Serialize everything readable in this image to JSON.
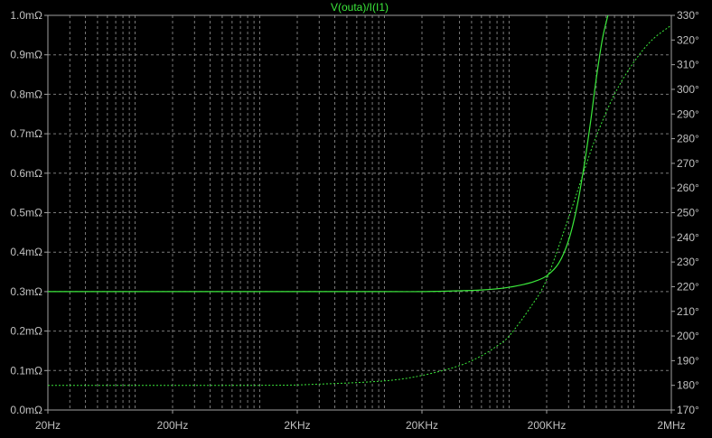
{
  "chart_data": {
    "type": "line",
    "title": "V(outa)/I(I1)",
    "x_scale": "log",
    "xlim": [
      20,
      2000000
    ],
    "x_ticks": [
      {
        "value": 20,
        "label": "20Hz"
      },
      {
        "value": 200,
        "label": "200Hz"
      },
      {
        "value": 2000,
        "label": "2KHz"
      },
      {
        "value": 20000,
        "label": "20KHz"
      },
      {
        "value": 200000,
        "label": "200KHz"
      },
      {
        "value": 2000000,
        "label": "2MHz"
      }
    ],
    "y_left": {
      "lim": [
        0,
        1.0
      ],
      "unit": "mΩ",
      "ticks": [
        {
          "value": 0.0,
          "label": "0.0mΩ"
        },
        {
          "value": 0.1,
          "label": "0.1mΩ"
        },
        {
          "value": 0.2,
          "label": "0.2mΩ"
        },
        {
          "value": 0.3,
          "label": "0.3mΩ"
        },
        {
          "value": 0.4,
          "label": "0.4mΩ"
        },
        {
          "value": 0.5,
          "label": "0.5mΩ"
        },
        {
          "value": 0.6,
          "label": "0.6mΩ"
        },
        {
          "value": 0.7,
          "label": "0.7mΩ"
        },
        {
          "value": 0.8,
          "label": "0.8mΩ"
        },
        {
          "value": 0.9,
          "label": "0.9mΩ"
        },
        {
          "value": 1.0,
          "label": "1.0mΩ"
        }
      ]
    },
    "y_right": {
      "lim": [
        170,
        330
      ],
      "unit": "°",
      "ticks": [
        {
          "value": 170,
          "label": "170°"
        },
        {
          "value": 180,
          "label": "180°"
        },
        {
          "value": 190,
          "label": "190°"
        },
        {
          "value": 200,
          "label": "200°"
        },
        {
          "value": 210,
          "label": "210°"
        },
        {
          "value": 220,
          "label": "220°"
        },
        {
          "value": 230,
          "label": "230°"
        },
        {
          "value": 240,
          "label": "240°"
        },
        {
          "value": 250,
          "label": "250°"
        },
        {
          "value": 260,
          "label": "260°"
        },
        {
          "value": 270,
          "label": "270°"
        },
        {
          "value": 280,
          "label": "280°"
        },
        {
          "value": 290,
          "label": "290°"
        },
        {
          "value": 300,
          "label": "300°"
        },
        {
          "value": 310,
          "label": "310°"
        },
        {
          "value": 320,
          "label": "320°"
        },
        {
          "value": 330,
          "label": "330°"
        }
      ]
    },
    "grid": true,
    "series": [
      {
        "kind": "magnitude",
        "axis": "left",
        "style": "solid",
        "color": "#3be83b",
        "x": [
          20,
          1000,
          10000,
          20000,
          40000,
          60000,
          80000,
          100000,
          130000,
          160000,
          200000,
          250000,
          300000,
          350000,
          400000,
          450000,
          500000,
          560000,
          620000
        ],
        "y": [
          0.3,
          0.3,
          0.3,
          0.3,
          0.302,
          0.304,
          0.307,
          0.311,
          0.318,
          0.326,
          0.34,
          0.372,
          0.43,
          0.515,
          0.62,
          0.73,
          0.84,
          0.94,
          1.0
        ]
      },
      {
        "kind": "phase",
        "axis": "right",
        "style": "dotted",
        "color": "#3be83b",
        "x": [
          20,
          1000,
          3000,
          10000,
          20000,
          40000,
          60000,
          80000,
          100000,
          150000,
          200000,
          300000,
          400000,
          500000,
          700000,
          1000000,
          1400000,
          2000000
        ],
        "y": [
          180,
          180,
          180.5,
          181.8,
          184,
          188,
          192,
          196,
          200,
          212,
          223,
          248,
          267,
          281,
          298,
          311,
          320,
          326
        ]
      }
    ]
  }
}
